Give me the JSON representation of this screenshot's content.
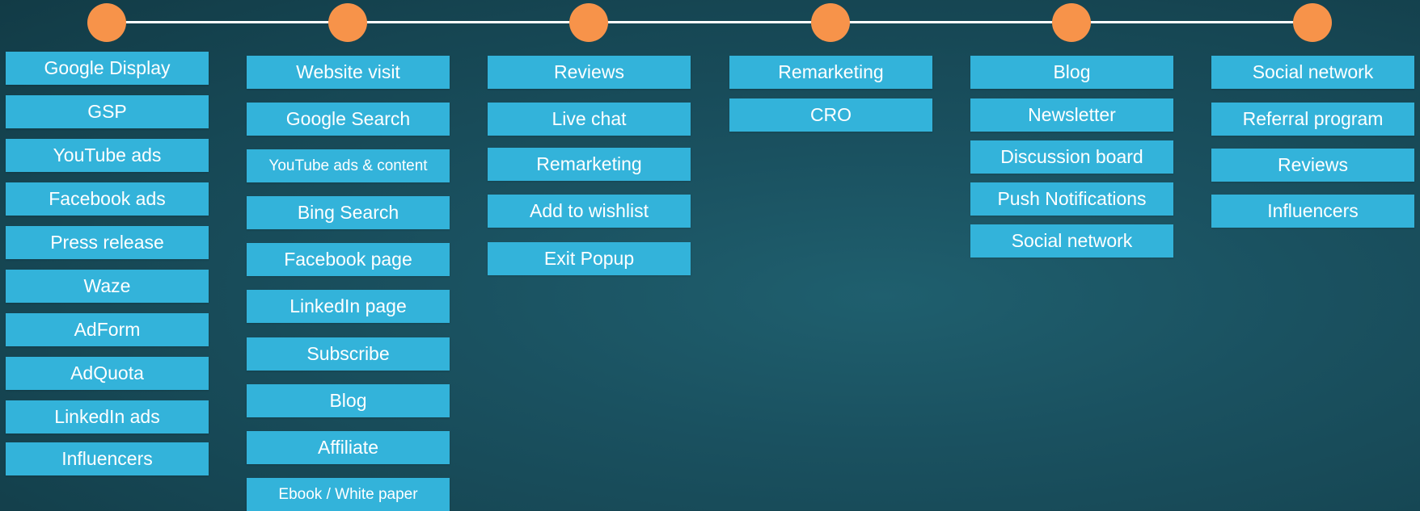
{
  "colors": {
    "node": "#f7934a",
    "box": "#33b3da",
    "line": "#ffffff",
    "text": "#ffffff",
    "background": "#164653"
  },
  "stages": [
    {
      "items": [
        "Google Display",
        "GSP",
        "YouTube ads",
        "Facebook ads",
        "Press release",
        "Waze",
        "AdForm",
        "AdQuota",
        "LinkedIn ads",
        "Influencers"
      ]
    },
    {
      "items": [
        "Website visit",
        "Google Search",
        "YouTube ads & content",
        "Bing Search",
        "Facebook page",
        "LinkedIn page",
        "Subscribe",
        "Blog",
        "Affiliate",
        "Ebook / White paper"
      ]
    },
    {
      "items": [
        "Reviews",
        "Live chat",
        "Remarketing",
        "Add to wishlist",
        "Exit Popup"
      ]
    },
    {
      "items": [
        "Remarketing",
        "CRO"
      ]
    },
    {
      "items": [
        "Blog",
        "Newsletter",
        "Discussion board",
        "Push Notifications",
        "Social network"
      ]
    },
    {
      "items": [
        "Social network",
        "Referral program",
        "Reviews",
        "Influencers"
      ]
    }
  ]
}
